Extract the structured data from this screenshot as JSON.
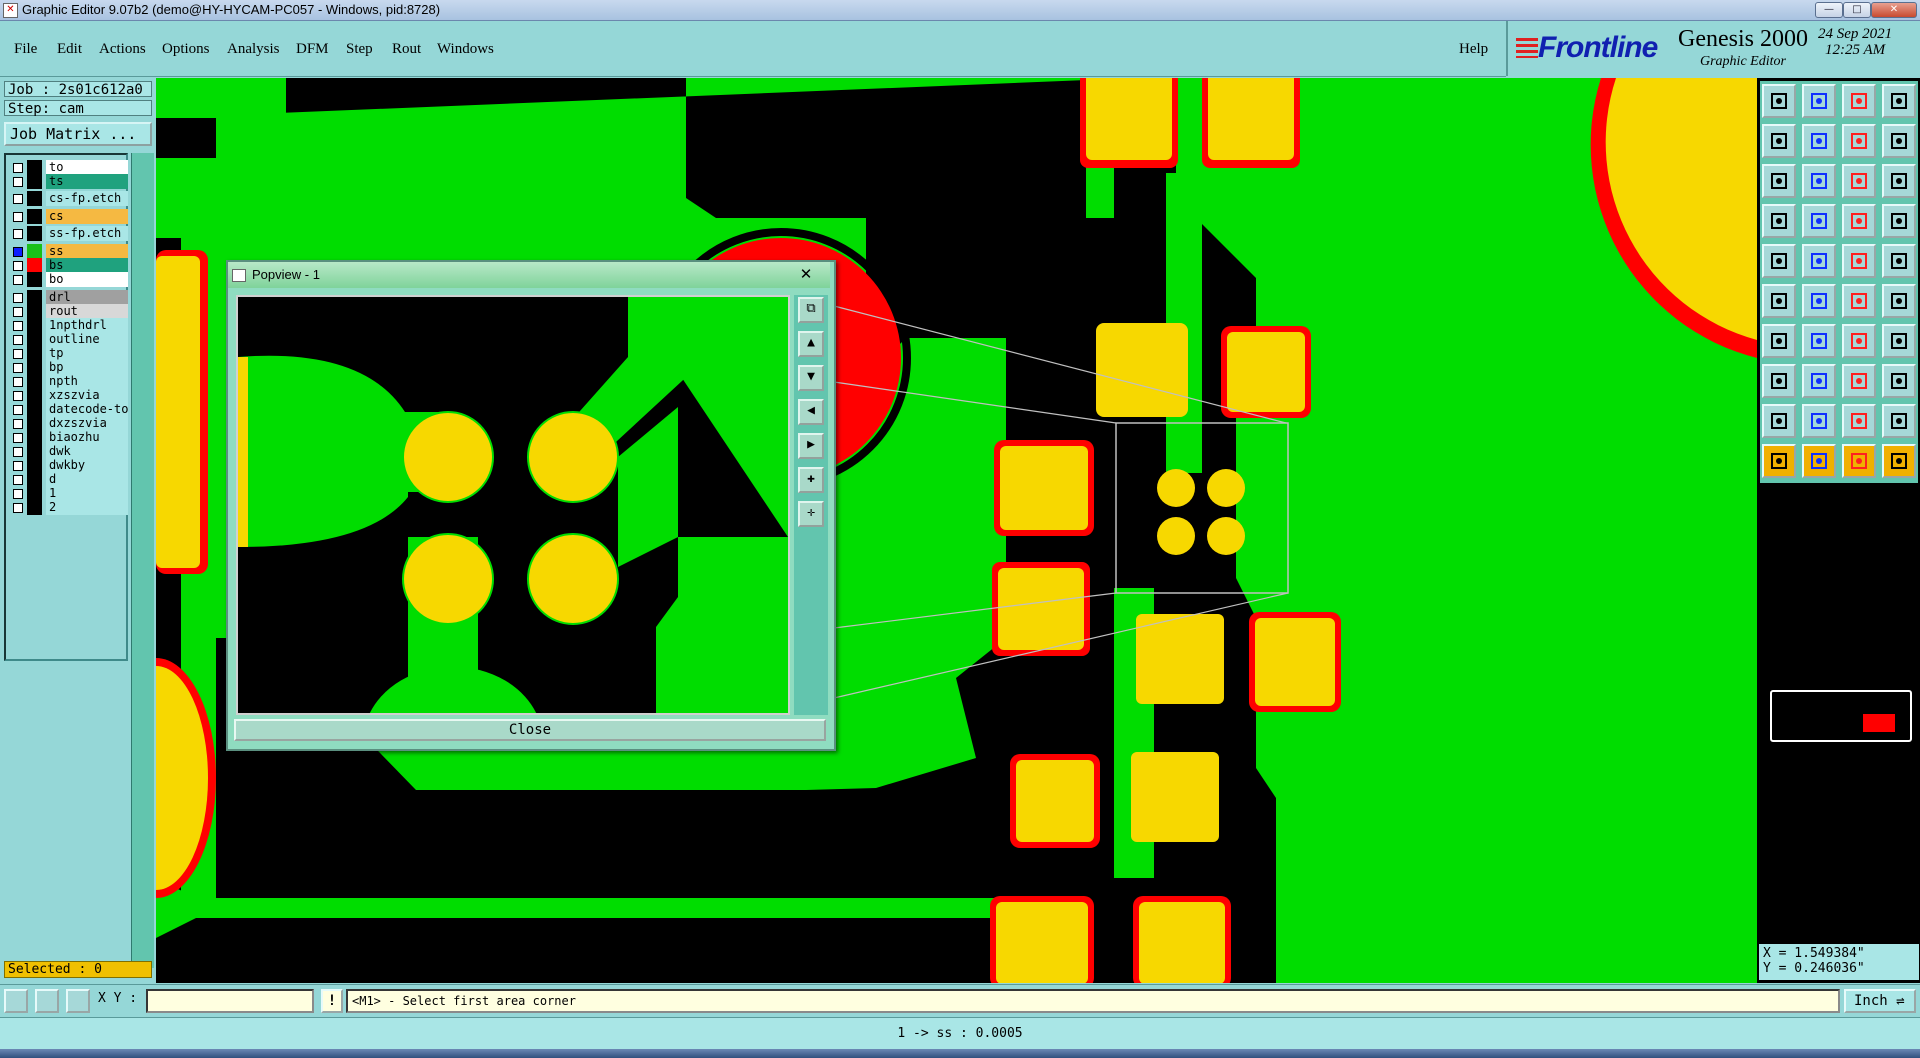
{
  "window": {
    "title": "Graphic Editor 9.07b2 (demo@HY-HYCAM-PC057 - Windows, pid:8728)"
  },
  "menu": {
    "items": [
      "File",
      "Edit",
      "Actions",
      "Options",
      "Analysis",
      "DFM",
      "Step",
      "Rout",
      "Windows"
    ],
    "help": "Help"
  },
  "brand": {
    "logo": "Frontline",
    "product": "Genesis 2000",
    "subtitle": "Graphic Editor",
    "date": "24 Sep 2021",
    "time": "12:25 AM"
  },
  "job": {
    "job_label": "Job : 2s01c612a0",
    "step_label": "Step: cam",
    "matrix_button": "Job Matrix ..."
  },
  "layers": [
    {
      "name": "to",
      "bg": "#ffffff",
      "swatch": "#000000",
      "active": false
    },
    {
      "name": "ts",
      "bg": "#1fa27e",
      "swatch": "#000000",
      "active": false
    },
    {
      "name": "cs-fp.etch",
      "bg": "#a9e6e6",
      "swatch": "#000000",
      "active": false
    },
    {
      "name": "cs",
      "bg": "#f5b942",
      "swatch": "#000000",
      "active": false
    },
    {
      "name": "ss-fp.etch",
      "bg": "#a9e6e6",
      "swatch": "#000000",
      "active": false
    },
    {
      "name": "ss",
      "bg": "#f5b942",
      "swatch": "#19c019",
      "active": true
    },
    {
      "name": "bs",
      "bg": "#1fa27e",
      "swatch": "#ff0000",
      "active": false
    },
    {
      "name": "bo",
      "bg": "#ffffff",
      "swatch": "#000000",
      "active": false
    },
    {
      "name": "drl",
      "bg": "#a0a0a0",
      "swatch": "#000000",
      "active": false
    },
    {
      "name": "rout",
      "bg": "#d8d8d8",
      "swatch": "#000000",
      "active": false
    },
    {
      "name": "1npthdrl",
      "bg": "#a9e6e6",
      "swatch": "#000000",
      "active": false
    },
    {
      "name": "outline",
      "bg": "#a9e6e6",
      "swatch": "#000000",
      "active": false
    },
    {
      "name": "tp",
      "bg": "#a9e6e6",
      "swatch": "#000000",
      "active": false
    },
    {
      "name": "bp",
      "bg": "#a9e6e6",
      "swatch": "#000000",
      "active": false
    },
    {
      "name": "npth",
      "bg": "#a9e6e6",
      "swatch": "#000000",
      "active": false
    },
    {
      "name": "xzszvia",
      "bg": "#a9e6e6",
      "swatch": "#000000",
      "active": false
    },
    {
      "name": "datecode-to",
      "bg": "#a9e6e6",
      "swatch": "#000000",
      "active": false
    },
    {
      "name": "dxzszvia",
      "bg": "#a9e6e6",
      "swatch": "#000000",
      "active": false
    },
    {
      "name": "biaozhu",
      "bg": "#a9e6e6",
      "swatch": "#000000",
      "active": false
    },
    {
      "name": "dwk",
      "bg": "#a9e6e6",
      "swatch": "#000000",
      "active": false
    },
    {
      "name": "dwkby",
      "bg": "#a9e6e6",
      "swatch": "#000000",
      "active": false
    },
    {
      "name": "d",
      "bg": "#a9e6e6",
      "swatch": "#000000",
      "active": false
    },
    {
      "name": "1",
      "bg": "#a9e6e6",
      "swatch": "#000000",
      "active": false
    },
    {
      "name": "2",
      "bg": "#a9e6e6",
      "swatch": "#000000",
      "active": false
    }
  ],
  "selected_label": "Selected : 0",
  "popview": {
    "title": "Popview - 1",
    "close_label": "Close",
    "close_x": "✕"
  },
  "coordinates": {
    "x": "X = 1.549384\"",
    "y": "Y = 0.246036\""
  },
  "command": {
    "xy_label": "X Y :",
    "xy_value": "",
    "bang": "!",
    "prompt": "<M1> - Select first area corner",
    "units": "Inch"
  },
  "status": "1 -> ss : 0.0005",
  "colors": {
    "copper": "#00dd00",
    "pad": "#f7d800",
    "mask": "#ff0000",
    "background": "#000000"
  }
}
